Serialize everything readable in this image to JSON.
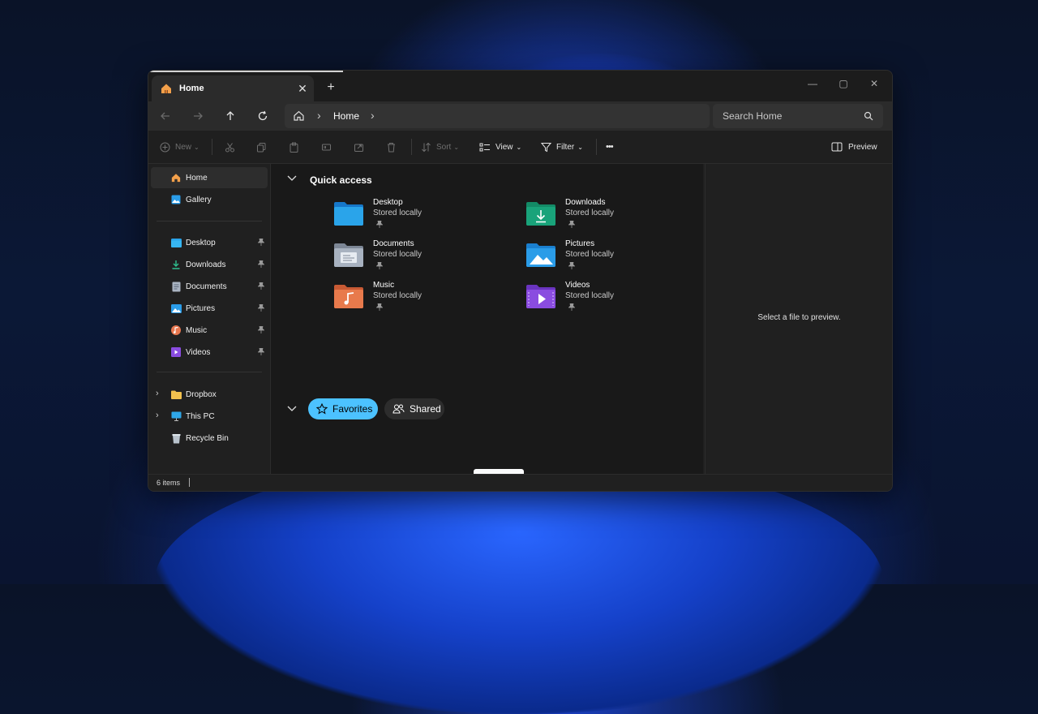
{
  "tab": {
    "title": "Home",
    "close_glyph": "✕",
    "new_glyph": "+"
  },
  "window_controls": {
    "minimize": "—",
    "maximize": "▢",
    "close": "✕"
  },
  "address": {
    "crumb": "Home",
    "sep": "›"
  },
  "search": {
    "placeholder": "Search Home"
  },
  "toolbar": {
    "new": "New",
    "sort": "Sort",
    "view": "View",
    "filter": "Filter",
    "more": "•••",
    "preview": "Preview"
  },
  "sidebar": {
    "top": [
      {
        "label": "Home",
        "icon": "home-icon"
      },
      {
        "label": "Gallery",
        "icon": "gallery-icon"
      }
    ],
    "pinned": [
      {
        "label": "Desktop",
        "icon": "desktop-folder-icon"
      },
      {
        "label": "Downloads",
        "icon": "downloads-icon"
      },
      {
        "label": "Documents",
        "icon": "documents-icon"
      },
      {
        "label": "Pictures",
        "icon": "pictures-icon"
      },
      {
        "label": "Music",
        "icon": "music-icon"
      },
      {
        "label": "Videos",
        "icon": "videos-icon"
      }
    ],
    "locations": [
      {
        "label": "Dropbox",
        "icon": "folder-icon",
        "expandable": true
      },
      {
        "label": "This PC",
        "icon": "monitor-icon",
        "expandable": true
      },
      {
        "label": "Recycle Bin",
        "icon": "recycle-bin-icon",
        "expandable": false
      }
    ]
  },
  "main": {
    "quick_access_title": "Quick access",
    "items": [
      {
        "name": "Desktop",
        "status": "Stored locally",
        "color": "#1a8fe0"
      },
      {
        "name": "Downloads",
        "status": "Stored locally",
        "color": "#19a37a"
      },
      {
        "name": "Documents",
        "status": "Stored locally",
        "color": "#9aa4b2"
      },
      {
        "name": "Pictures",
        "status": "Stored locally",
        "color": "#2a9ce8"
      },
      {
        "name": "Music",
        "status": "Stored locally",
        "color": "#e87a4c"
      },
      {
        "name": "Videos",
        "status": "Stored locally",
        "color": "#8a4ce0"
      }
    ],
    "tabs": {
      "favorites": "Favorites",
      "shared": "Shared"
    }
  },
  "preview_pane": {
    "message": "Select a file to preview."
  },
  "status": {
    "count": "6 items"
  },
  "colors": {
    "accent": "#4cc2ff",
    "window_bg": "#202020",
    "content_bg": "#191919"
  }
}
